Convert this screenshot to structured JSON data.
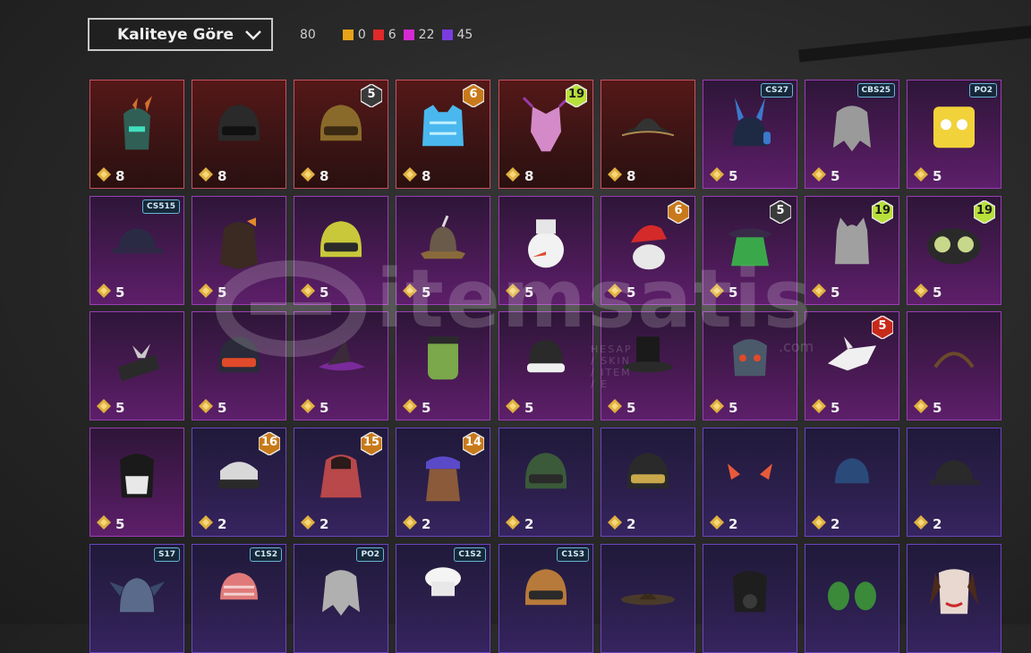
{
  "sort": {
    "label": "Kaliteye Göre"
  },
  "counts": {
    "total": "80",
    "qualities": [
      {
        "value": "0",
        "color": "#e8a21a"
      },
      {
        "value": "6",
        "color": "#e02a2a"
      },
      {
        "value": "22",
        "color": "#d42ad4"
      },
      {
        "value": "45",
        "color": "#7a3ce0"
      }
    ]
  },
  "watermark": {
    "brand": "itemsatis",
    "tagline": "HESAP / SKIN / ITEM / E",
    "domain": ".com"
  },
  "items": [
    {
      "price": "8",
      "rarity": "red",
      "icon": "dragon-helmet-icon"
    },
    {
      "price": "8",
      "rarity": "red",
      "icon": "black-helmet-icon"
    },
    {
      "price": "8",
      "rarity": "red",
      "icon": "gold-mask-helmet-icon",
      "badge": "5",
      "badge_color": "#3a3a3a"
    },
    {
      "price": "8",
      "rarity": "red",
      "icon": "ice-vest-icon",
      "badge": "6",
      "badge_color": "#c87a1a"
    },
    {
      "price": "8",
      "rarity": "red",
      "icon": "pink-demon-mask-icon",
      "badge": "19",
      "badge_color": "#b8e03a"
    },
    {
      "price": "8",
      "rarity": "red",
      "icon": "pirate-hat-icon"
    },
    {
      "price": "5",
      "rarity": "purple",
      "icon": "bunny-ears-helmet-icon",
      "label": "CS27"
    },
    {
      "price": "5",
      "rarity": "purple",
      "icon": "gray-hair-icon",
      "label": "CBS25"
    },
    {
      "price": "5",
      "rarity": "purple",
      "icon": "yellow-cube-head-icon",
      "label": "PO2"
    },
    {
      "price": "5",
      "rarity": "purple",
      "icon": "purple-cap-icon",
      "label": "CS515"
    },
    {
      "price": "5",
      "rarity": "purple",
      "icon": "brown-hair-bow-icon"
    },
    {
      "price": "5",
      "rarity": "purple",
      "icon": "yellow-moto-helmet-icon"
    },
    {
      "price": "5",
      "rarity": "purple",
      "icon": "bronze-helmet-icon"
    },
    {
      "price": "5",
      "rarity": "purple",
      "icon": "snowman-head-icon"
    },
    {
      "price": "5",
      "rarity": "purple",
      "icon": "santa-hat-icon",
      "badge": "6",
      "badge_color": "#c87a1a"
    },
    {
      "price": "5",
      "rarity": "purple",
      "icon": "witch-hat-green-hair-icon",
      "badge": "5",
      "badge_color": "#3a3a3a"
    },
    {
      "price": "5",
      "rarity": "purple",
      "icon": "cat-ear-hair-icon",
      "badge": "19",
      "badge_color": "#b8e03a"
    },
    {
      "price": "5",
      "rarity": "purple",
      "icon": "bug-eye-head-icon",
      "badge": "19",
      "badge_color": "#b8e03a"
    },
    {
      "price": "5",
      "rarity": "purple",
      "icon": "bow-hat-icon"
    },
    {
      "price": "5",
      "rarity": "purple",
      "icon": "orange-visor-helmet-icon"
    },
    {
      "price": "5",
      "rarity": "purple",
      "icon": "purple-witch-hat-icon"
    },
    {
      "price": "5",
      "rarity": "purple",
      "icon": "frankenstein-head-icon"
    },
    {
      "price": "5",
      "rarity": "purple",
      "icon": "beanie-icon"
    },
    {
      "price": "5",
      "rarity": "purple",
      "icon": "top-hat-icon"
    },
    {
      "price": "5",
      "rarity": "purple",
      "icon": "robot-mask-icon"
    },
    {
      "price": "5",
      "rarity": "purple",
      "icon": "dragon-skull-icon",
      "badge": "5",
      "badge_color": "#c82a1a"
    },
    {
      "price": "5",
      "rarity": "purple",
      "icon": "headband-icon"
    },
    {
      "price": "5",
      "rarity": "purple",
      "icon": "skull-mask-icon"
    },
    {
      "price": "2",
      "rarity": "violet",
      "icon": "bandana-goggles-icon",
      "badge": "16",
      "badge_color": "#c87a1a"
    },
    {
      "price": "2",
      "rarity": "violet",
      "icon": "pumpkin-hair-icon",
      "badge": "15",
      "badge_color": "#c87a1a"
    },
    {
      "price": "2",
      "rarity": "violet",
      "icon": "cat-cap-hair-icon",
      "badge": "14",
      "badge_color": "#c87a1a"
    },
    {
      "price": "2",
      "rarity": "violet",
      "icon": "gas-mask-helmet-icon"
    },
    {
      "price": "2",
      "rarity": "violet",
      "icon": "gold-visor-helmet-icon"
    },
    {
      "price": "2",
      "rarity": "violet",
      "icon": "devil-horns-icon"
    },
    {
      "price": "2",
      "rarity": "violet",
      "icon": "blue-beanie-icon"
    },
    {
      "price": "2",
      "rarity": "violet",
      "icon": "mesh-cap-icon"
    },
    {
      "price": "",
      "rarity": "violet",
      "icon": "knight-helmet-icon",
      "label": "S17"
    },
    {
      "price": "",
      "rarity": "violet",
      "icon": "pink-bandana-icon",
      "label": "C1S2"
    },
    {
      "price": "",
      "rarity": "violet",
      "icon": "silver-hair-icon",
      "label": "PO2"
    },
    {
      "price": "",
      "rarity": "violet",
      "icon": "chef-hat-icon",
      "label": "C1S2"
    },
    {
      "price": "",
      "rarity": "violet",
      "icon": "copper-helmet-icon",
      "label": "C1S3"
    },
    {
      "price": "",
      "rarity": "violet",
      "icon": "sombrero-icon"
    },
    {
      "price": "",
      "rarity": "violet",
      "icon": "black-gas-mask-icon"
    },
    {
      "price": "",
      "rarity": "violet",
      "icon": "green-pigtails-icon"
    },
    {
      "price": "",
      "rarity": "violet",
      "icon": "clown-mask-icon"
    }
  ]
}
